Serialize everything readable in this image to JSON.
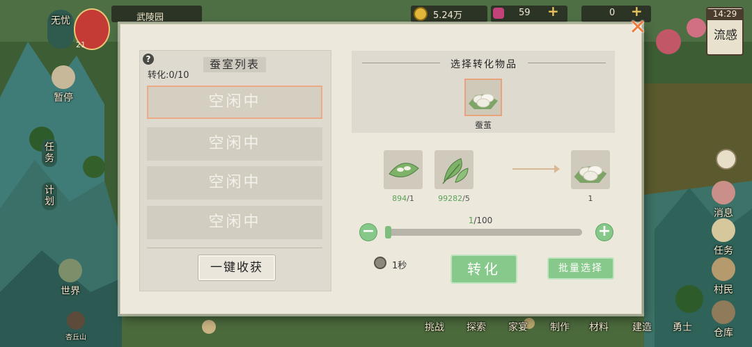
{
  "hud": {
    "player_name_left": "无忧",
    "player_level": "21",
    "location": "武陵园",
    "coins": "5.24万",
    "gems": "59",
    "tickets": "0",
    "clock": "14:29",
    "season_label": "流感",
    "side_left": [
      "暂停",
      "任务",
      "计划",
      "世界",
      "杏丘山"
    ],
    "side_right": [
      "消息",
      "任务",
      "村民",
      "仓库"
    ],
    "bottom": [
      "挑战",
      "探索",
      "家宴",
      "制作",
      "材料",
      "建造",
      "勇士"
    ]
  },
  "dialog": {
    "close_label": "✕",
    "left": {
      "help_label": "?",
      "convert_count": "转化:0/10",
      "title": "蚕室列表",
      "slots": [
        "空闲中",
        "空闲中",
        "空闲中",
        "空闲中"
      ],
      "harvest_button": "一键收获"
    },
    "right": {
      "pick_title": "选择转化物品",
      "selected_item": "蚕茧",
      "materials": [
        {
          "have": "894",
          "need": "/1"
        },
        {
          "have": "99282",
          "need": "/5"
        }
      ],
      "product_count": "1",
      "quantity_current": "1",
      "quantity_max": "/100",
      "minus_label": "−",
      "plus_label": "+",
      "time": "1秒",
      "convert_button": "转化",
      "batch_button": "批量选择"
    }
  }
}
